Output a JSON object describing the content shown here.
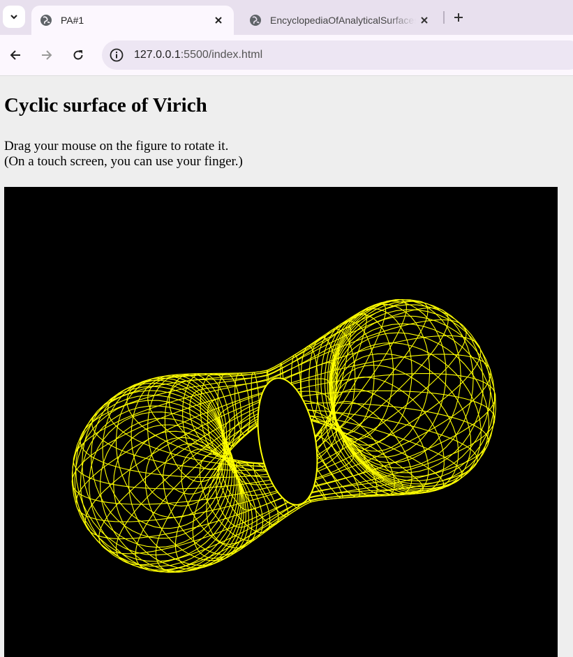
{
  "browser": {
    "tabs": [
      {
        "title": "PA#1",
        "active": true
      },
      {
        "title": "EncyclopediaOfAnalyticalSurfaces",
        "active": false
      }
    ],
    "url_host": "127.0.0.1",
    "url_rest": ":5500/index.html"
  },
  "page": {
    "heading": "Cyclic surface of Virich",
    "instruction_line1": "Drag your mouse on the figure to rotate it.",
    "instruction_line2": "(On a touch screen, you can use your finger.)"
  },
  "figure": {
    "background_color": "#000000",
    "wire_color": "#ffff00"
  },
  "icons": {
    "tab_menu": "chevron-down-icon",
    "tab_favicon": "globe-icon",
    "tab_close": "close-icon",
    "new_tab": "plus-icon",
    "back": "back-arrow-icon",
    "forward": "forward-arrow-icon",
    "reload": "reload-icon",
    "site_info": "info-icon"
  }
}
